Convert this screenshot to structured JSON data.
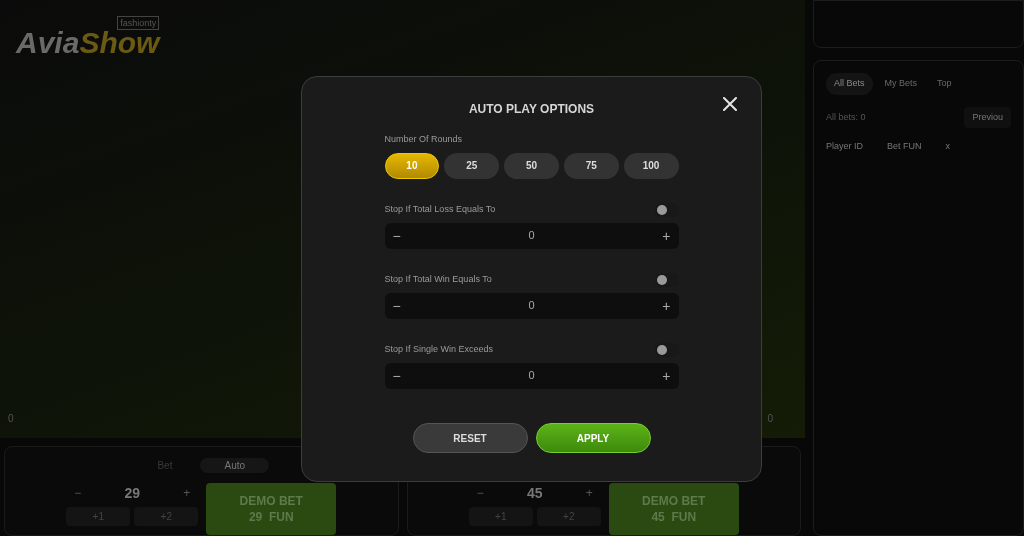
{
  "logo": {
    "part_1": "Avia",
    "part_2": "Show",
    "tag": "fashionty"
  },
  "game": {
    "left_count": "0",
    "right_count": "0"
  },
  "bet_panels": [
    {
      "tabs": [
        {
          "label": "Bet",
          "selected": false
        },
        {
          "label": "Auto",
          "selected": true
        }
      ],
      "minus": "−",
      "amount": "29",
      "plus": "+",
      "quick": [
        "+1",
        "+2"
      ],
      "button_line_1": "DEMO BET",
      "button_line_2": "29  FUN"
    },
    {
      "minus": "−",
      "amount": "45",
      "plus": "+",
      "quick": [
        "+1",
        "+2"
      ],
      "button_line_1": "DEMO BET",
      "button_line_2": "45  FUN"
    }
  ],
  "bets": {
    "tabs": [
      {
        "label": "All Bets",
        "selected": true
      },
      {
        "label": "My Bets",
        "selected": false
      },
      {
        "label": "Top",
        "selected": false
      }
    ],
    "count": "All bets: 0",
    "previous": "Previou",
    "columns": [
      "Player ID",
      "Bet FUN",
      "x"
    ]
  },
  "modal": {
    "title": "AUTO PLAY OPTIONS",
    "rounds_label": "Number Of Rounds",
    "rounds": [
      {
        "label": "10",
        "selected": true
      },
      {
        "label": "25",
        "selected": false
      },
      {
        "label": "50",
        "selected": false
      },
      {
        "label": "75",
        "selected": false
      },
      {
        "label": "100",
        "selected": false
      }
    ],
    "conditions": [
      {
        "label": "Stop If Total Loss Equals To",
        "on": false,
        "minus": "−",
        "value": "0",
        "plus": "+"
      },
      {
        "label": "Stop If Total Win Equals To",
        "on": false,
        "minus": "−",
        "value": "0",
        "plus": "+"
      },
      {
        "label": "Stop If Single Win Exceeds",
        "on": false,
        "minus": "−",
        "value": "0",
        "plus": "+"
      }
    ],
    "reset": "RESET",
    "apply": "APPLY"
  }
}
